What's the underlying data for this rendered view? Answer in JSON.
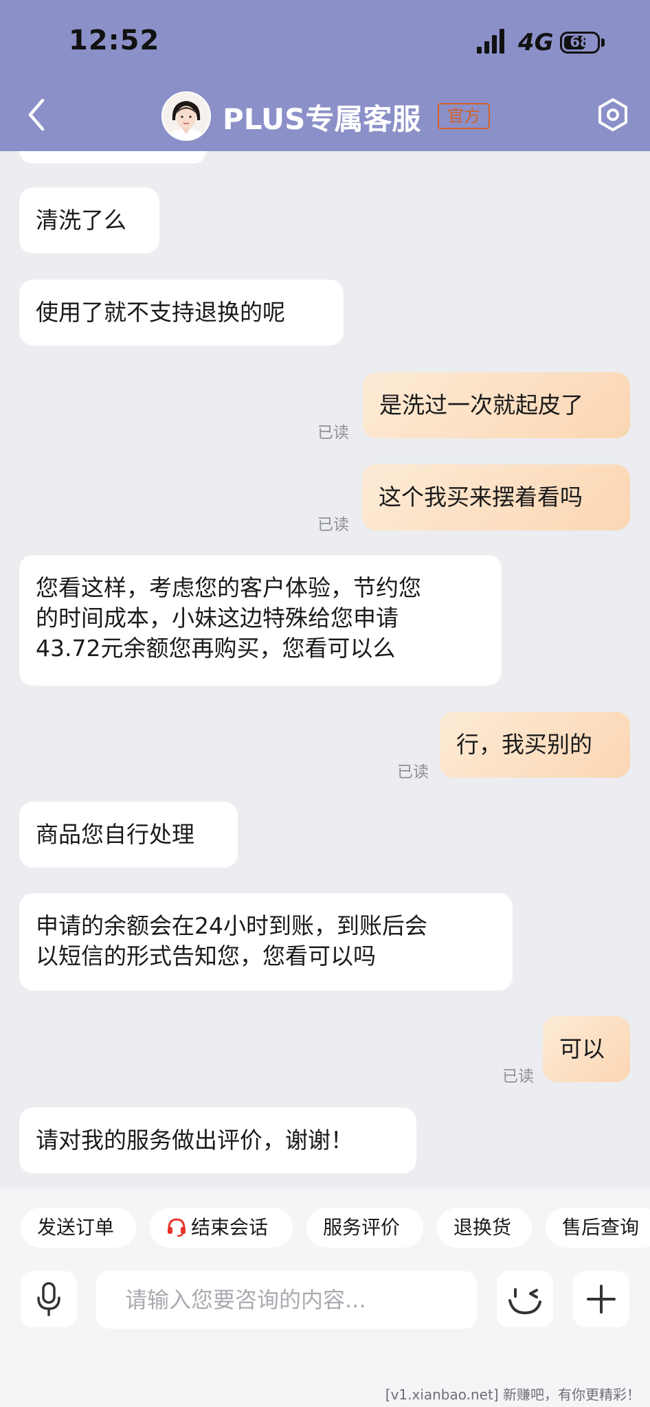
{
  "status_bar": {
    "time": "12:52",
    "network": "4G",
    "battery": "68",
    "battery_level": 0.68
  },
  "header": {
    "title": "PLUS专属客服",
    "badge": "官方",
    "back_icon": "chevron-left-icon",
    "settings_icon": "hexagon-gear-icon"
  },
  "messages": [
    {
      "sender": "agent",
      "lines": [
        "清洗了么"
      ]
    },
    {
      "sender": "agent",
      "lines": [
        "使用了就不支持退换的呢"
      ]
    },
    {
      "sender": "user",
      "lines": [
        "是洗过一次就起皮了"
      ],
      "status": "已读"
    },
    {
      "sender": "user",
      "lines": [
        "这个我买来摆着看吗"
      ],
      "status": "已读"
    },
    {
      "sender": "agent",
      "lines": [
        "您看这样，考虑您的客户体验，节约您",
        "的时间成本，小妹这边特殊给您申请",
        "43.72元余额您再购买，您看可以么"
      ]
    },
    {
      "sender": "user",
      "lines": [
        "行，我买别的"
      ],
      "status": "已读"
    },
    {
      "sender": "agent",
      "lines": [
        "商品您自行处理"
      ]
    },
    {
      "sender": "agent",
      "lines": [
        "申请的余额会在24小时到账，到账后会",
        "以短信的形式告知您，您看可以吗"
      ]
    },
    {
      "sender": "user",
      "lines": [
        "可以"
      ],
      "status": "已读"
    },
    {
      "sender": "agent",
      "lines": [
        "请对我的服务做出评价，谢谢！"
      ]
    }
  ],
  "quick_actions": [
    "发送订单",
    "结束会话",
    "服务评价",
    "退换货",
    "售后查询"
  ],
  "quick_action_icons": {
    "结束会话": "headset-icon"
  },
  "input": {
    "placeholder": "请输入您要咨询的内容..."
  },
  "toolbar_icons": [
    "microphone-icon",
    "emoji-icon",
    "plus-icon"
  ],
  "colors": {
    "header_bg": "#8b90c8",
    "chat_bg": "#ebedf0",
    "user_bubble": "#fbd9b8",
    "agent_bubble": "#ffffff",
    "badge": "#d2622a",
    "headset_icon": "#e8342a"
  },
  "watermark": "[v1.xianbao.net] 新赚吧，有你更精彩！"
}
